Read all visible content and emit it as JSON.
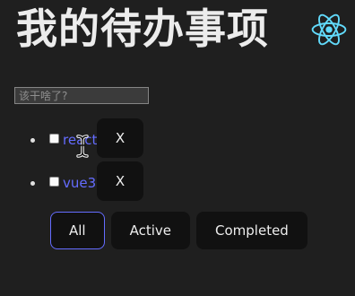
{
  "header": {
    "title": "我的待办事项",
    "logo_icon": "react-logo-icon"
  },
  "new_todo": {
    "placeholder": "该干啥了?",
    "value": ""
  },
  "todos": [
    {
      "label": "react",
      "completed": false,
      "delete_label": "X"
    },
    {
      "label": "vue3",
      "completed": false,
      "delete_label": "X"
    }
  ],
  "filters": [
    {
      "label": "All",
      "active": true
    },
    {
      "label": "Active",
      "active": false
    },
    {
      "label": "Completed",
      "active": false
    }
  ],
  "colors": {
    "background": "#1f1f1f",
    "accent": "#646cff",
    "react_logo": "#61dafb",
    "button_bg": "#111111"
  }
}
